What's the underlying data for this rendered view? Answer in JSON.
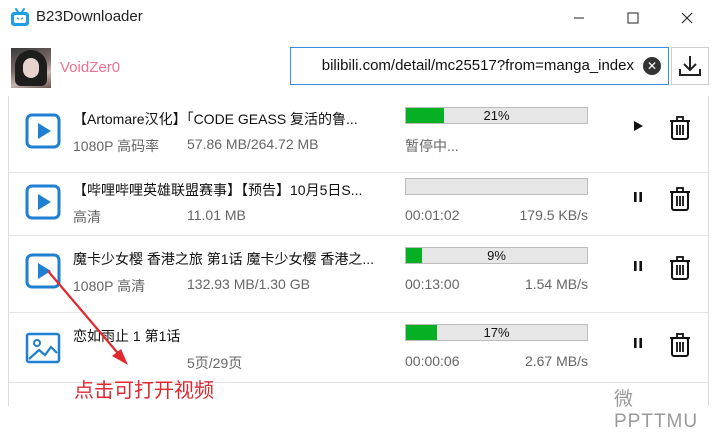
{
  "window": {
    "title": "B23Downloader",
    "minimize_icon": "minimize-icon",
    "maximize_icon": "maximize-icon",
    "close_icon": "close-icon"
  },
  "header": {
    "username": "VoidZer0",
    "url_value": "bilibili.com/detail/mc25517?from=manga_index",
    "url_visible": "bilibili.com/detail/mc25517?from=manga_index",
    "clear_icon": "clear-icon",
    "download_icon": "download-icon"
  },
  "items": [
    {
      "name": "【Artomare汉化】「CODE GEASS 复活的鲁...",
      "quality": "1080P 高码率",
      "size": "57.86 MB/264.72 MB",
      "progress_label": "21%",
      "progress_fraction": 0.21,
      "status": "暂停中...",
      "speed": "",
      "action_icon": "play-icon",
      "thumb_icon": "video-icon"
    },
    {
      "name": "【哔哩哔哩英雄联盟赛事】【预告】10月5日S...",
      "quality": "高清",
      "size": "11.01 MB",
      "progress_label": "",
      "progress_fraction": 0.0,
      "status": "00:01:02",
      "speed": "179.5 KB/s",
      "action_icon": "pause-icon",
      "thumb_icon": "video-icon"
    },
    {
      "name": "魔卡少女樱 香港之旅 第1话 魔卡少女樱 香港之...",
      "quality": "1080P 高清",
      "size": "132.93 MB/1.30 GB",
      "progress_label": "9%",
      "progress_fraction": 0.09,
      "status": "00:13:00",
      "speed": "1.54 MB/s",
      "action_icon": "pause-icon",
      "thumb_icon": "video-icon"
    },
    {
      "name": "恋如雨止 1 第1话",
      "quality": "",
      "size": "5页/29页",
      "progress_label": "17%",
      "progress_fraction": 0.17,
      "status": "00:00:06",
      "speed": "2.67 MB/s",
      "action_icon": "pause-icon",
      "thumb_icon": "image-icon"
    }
  ],
  "annotation": {
    "text": "点击可打开视频",
    "color": "#e0282f"
  },
  "watermark": "微 PPTTMU",
  "colors": {
    "accent": "#3a8ee6",
    "progress": "#06b025",
    "username": "#f07291",
    "icon_blue": "#1f7fd0"
  }
}
